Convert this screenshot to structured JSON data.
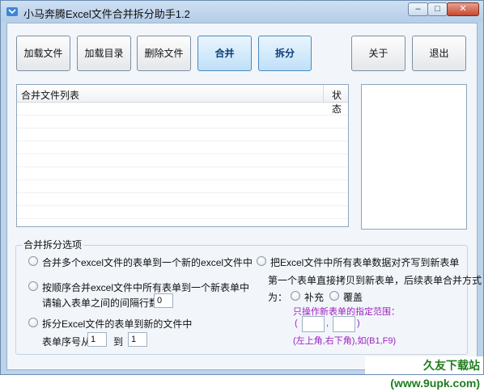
{
  "window": {
    "title": "小马奔腾Excel文件合并拆分助手1.2"
  },
  "toolbar": {
    "add_files": "加载文件",
    "add_folder": "加载目录",
    "delete_files": "删除文件",
    "merge": "合并",
    "split": "拆分",
    "about": "关于",
    "exit": "退出"
  },
  "file_list": {
    "col_name": "合并文件列表",
    "col_status": "状态"
  },
  "options": {
    "title": "合并拆分选项",
    "opt1": "合并多个excel文件的表单到一个新的excel文件中",
    "opt2": "按顺序合并excel文件中所有表单到一个新表单中",
    "opt2_interval_label": "请输入表单之间的间隔行数",
    "opt2_interval_value": "0",
    "opt3": "拆分Excel文件的表单到新的文件中",
    "opt3_from_label": "表单序号从",
    "opt3_from_value": "1",
    "opt3_to_label": "到",
    "opt3_to_value": "1",
    "opt4": "把Excel文件中所有表单数据对齐写到新表单",
    "opt4_desc": "第一个表单直接拷贝到新表单，后续表单合并方式",
    "opt4_mode_label": "为：",
    "mode_append": "补充",
    "mode_overwrite": "覆盖",
    "range_hint": "只操作新表单的指定范围：",
    "range_open": "(",
    "range_comma": ",",
    "range_close": ")",
    "range_example": "(左上角,右下角),如(B1,F9)"
  },
  "watermark": "久友下载站(www.9upk.com)"
}
